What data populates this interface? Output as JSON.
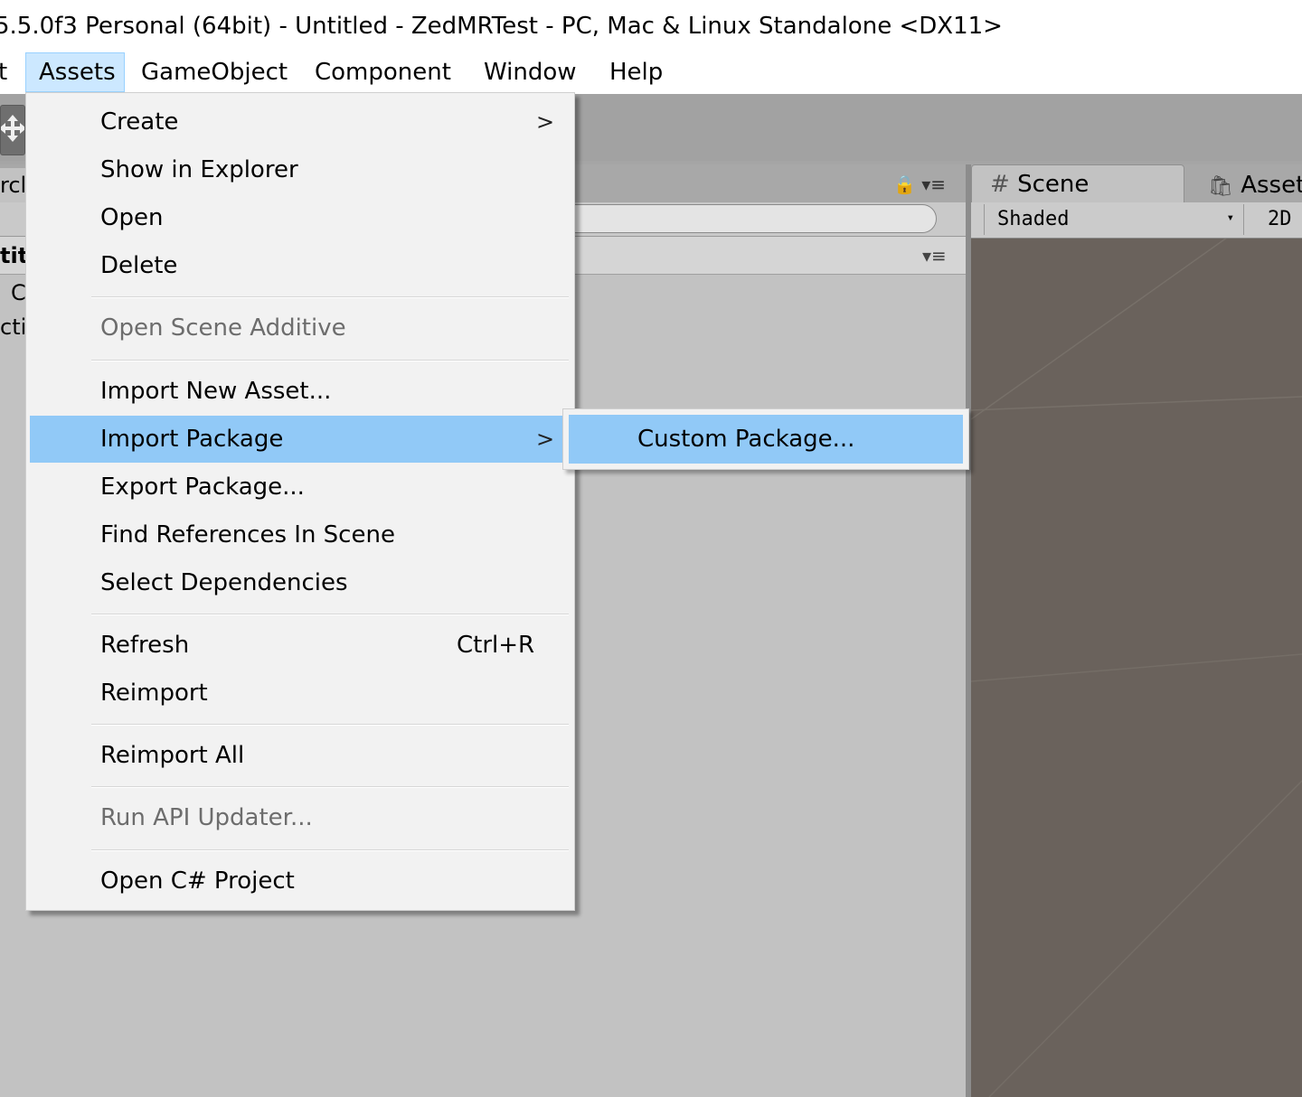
{
  "window": {
    "title": "5.5.0f3 Personal (64bit) - Untitled - ZedMRTest - PC, Mac & Linux Standalone <DX11>"
  },
  "menubar": {
    "items": [
      {
        "label": "t"
      },
      {
        "label": "Assets",
        "active": true
      },
      {
        "label": "GameObject"
      },
      {
        "label": "Component"
      },
      {
        "label": "Window"
      },
      {
        "label": "Help"
      }
    ]
  },
  "assets_menu": {
    "items": [
      {
        "label": "Create",
        "submenu": true
      },
      {
        "label": "Show in Explorer"
      },
      {
        "label": "Open"
      },
      {
        "label": "Delete"
      },
      {
        "label": "Open Scene Additive",
        "disabled": true
      },
      {
        "label": "Import New Asset..."
      },
      {
        "label": "Import Package",
        "submenu": true,
        "highlighted": true
      },
      {
        "label": "Export Package..."
      },
      {
        "label": "Find References In Scene"
      },
      {
        "label": "Select Dependencies"
      },
      {
        "label": "Refresh",
        "shortcut": "Ctrl+R"
      },
      {
        "label": "Reimport"
      },
      {
        "label": "Reimport All"
      },
      {
        "label": "Run API Updater...",
        "disabled": true
      },
      {
        "label": "Open C# Project"
      }
    ],
    "submenu_arrow": ">"
  },
  "import_package_submenu": {
    "items": [
      {
        "label": "Custom Package...",
        "highlighted": true
      }
    ]
  },
  "hierarchy": {
    "tab_label": "rcl",
    "scene_name": "tit",
    "rows": [
      "C",
      "cti"
    ],
    "options_glyph": "▾≡",
    "lock_glyph": "🔒 ▾≡"
  },
  "scene_panel": {
    "tab_label": "Scene",
    "tab_icon": "#",
    "asset_tab_label": "Asset",
    "shading_mode": "Shaded",
    "mode_2d": "2D"
  },
  "colors": {
    "menu_highlight": "#91c9f7",
    "menubar_active": "#cce8ff",
    "scene_background": "#6a625c",
    "editor_gray": "#c2c2c2"
  }
}
